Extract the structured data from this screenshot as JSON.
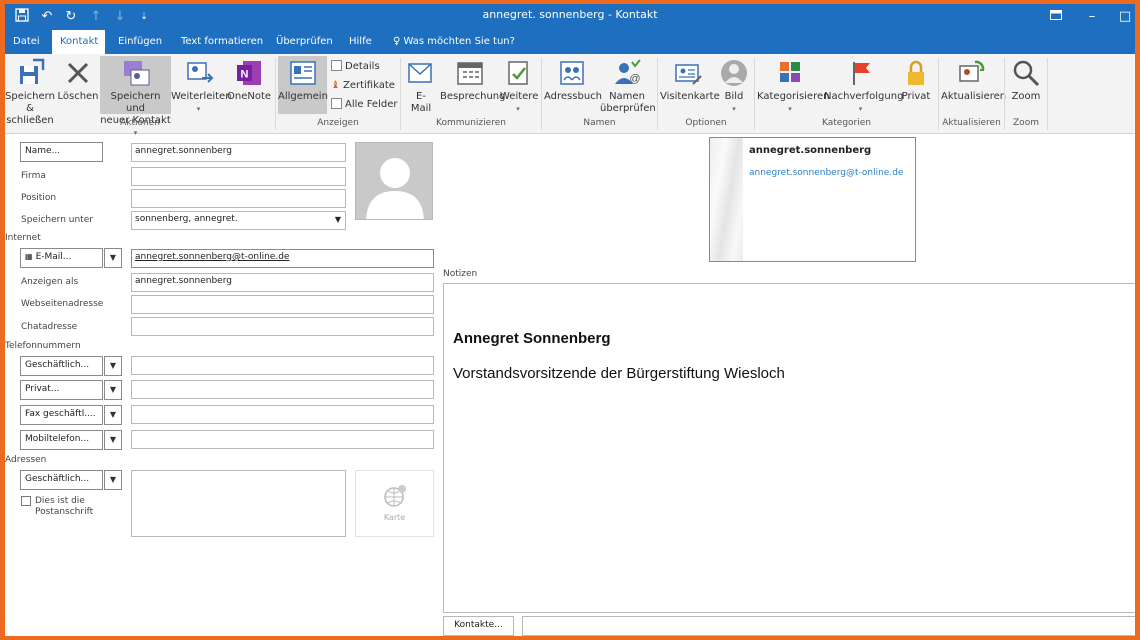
{
  "window": {
    "title": "annegret. sonnenberg  -  Kontakt"
  },
  "tabs": [
    "Datei",
    "Kontakt",
    "Einfügen",
    "Text formatieren",
    "Überprüfen",
    "Hilfe"
  ],
  "tell_me": "Was möchten Sie tun?",
  "ribbon": {
    "save_close": [
      "Speichern",
      "& schließen"
    ],
    "delete": "Löschen",
    "save_new": [
      "Speichern und",
      "neuer Kontakt"
    ],
    "forward": "Weiterleiten",
    "onenote": "OneNote",
    "general": "Allgemein",
    "details": "Details",
    "certificates": "Zertifikate",
    "all_fields": "Alle Felder",
    "email": [
      "E-",
      "Mail"
    ],
    "meeting": "Besprechung",
    "more": "Weitere",
    "address_book": "Adressbuch",
    "check_names": [
      "Namen",
      "überprüfen"
    ],
    "business_card": "Visitenkarte",
    "picture": "Bild",
    "categorize": "Kategorisieren",
    "followup": "Nachverfolgung",
    "private": "Privat",
    "update": "Aktualisieren",
    "zoom": "Zoom",
    "groups": [
      "Aktionen",
      "Anzeigen",
      "Kommunizieren",
      "Namen",
      "Optionen",
      "Kategorien",
      "Aktualisieren",
      "Zoom"
    ]
  },
  "form": {
    "name_button": "Name...",
    "name_value": "annegret.sonnenberg",
    "company_label": "Firma",
    "position_label": "Position",
    "file_as_label": "Speichern unter",
    "file_as_value": "sonnenberg, annegret.",
    "internet_section": "Internet",
    "email_button": "E-Mail...",
    "email_value": "annegret.sonnenberg@t-online.de",
    "display_as_label": "Anzeigen als",
    "display_as_value": "annegret.sonnenberg",
    "web_label": "Webseitenadresse",
    "im_label": "Chatadresse",
    "phone_section": "Telefonnummern",
    "phones": [
      "Geschäftlich...",
      "Privat...",
      "Fax geschäftl....",
      "Mobiltelefon..."
    ],
    "address_section": "Adressen",
    "address_button": "Geschäftlich...",
    "mailing_checkbox": [
      "Dies ist die",
      "Postanschrift"
    ],
    "map_label": "Karte",
    "notes_label": "Notizen",
    "notes_name": "Annegret Sonnenberg",
    "notes_title": "Vorstandsvorsitzende der Bürgerstiftung Wiesloch",
    "contacts_button": "Kontakte..."
  },
  "business_card": {
    "name": "annegret.sonnenberg",
    "email": "annegret.sonnenberg@t-online.de"
  },
  "colors": {
    "accent": "#1e6fc0",
    "frame": "#ee6a1e"
  }
}
